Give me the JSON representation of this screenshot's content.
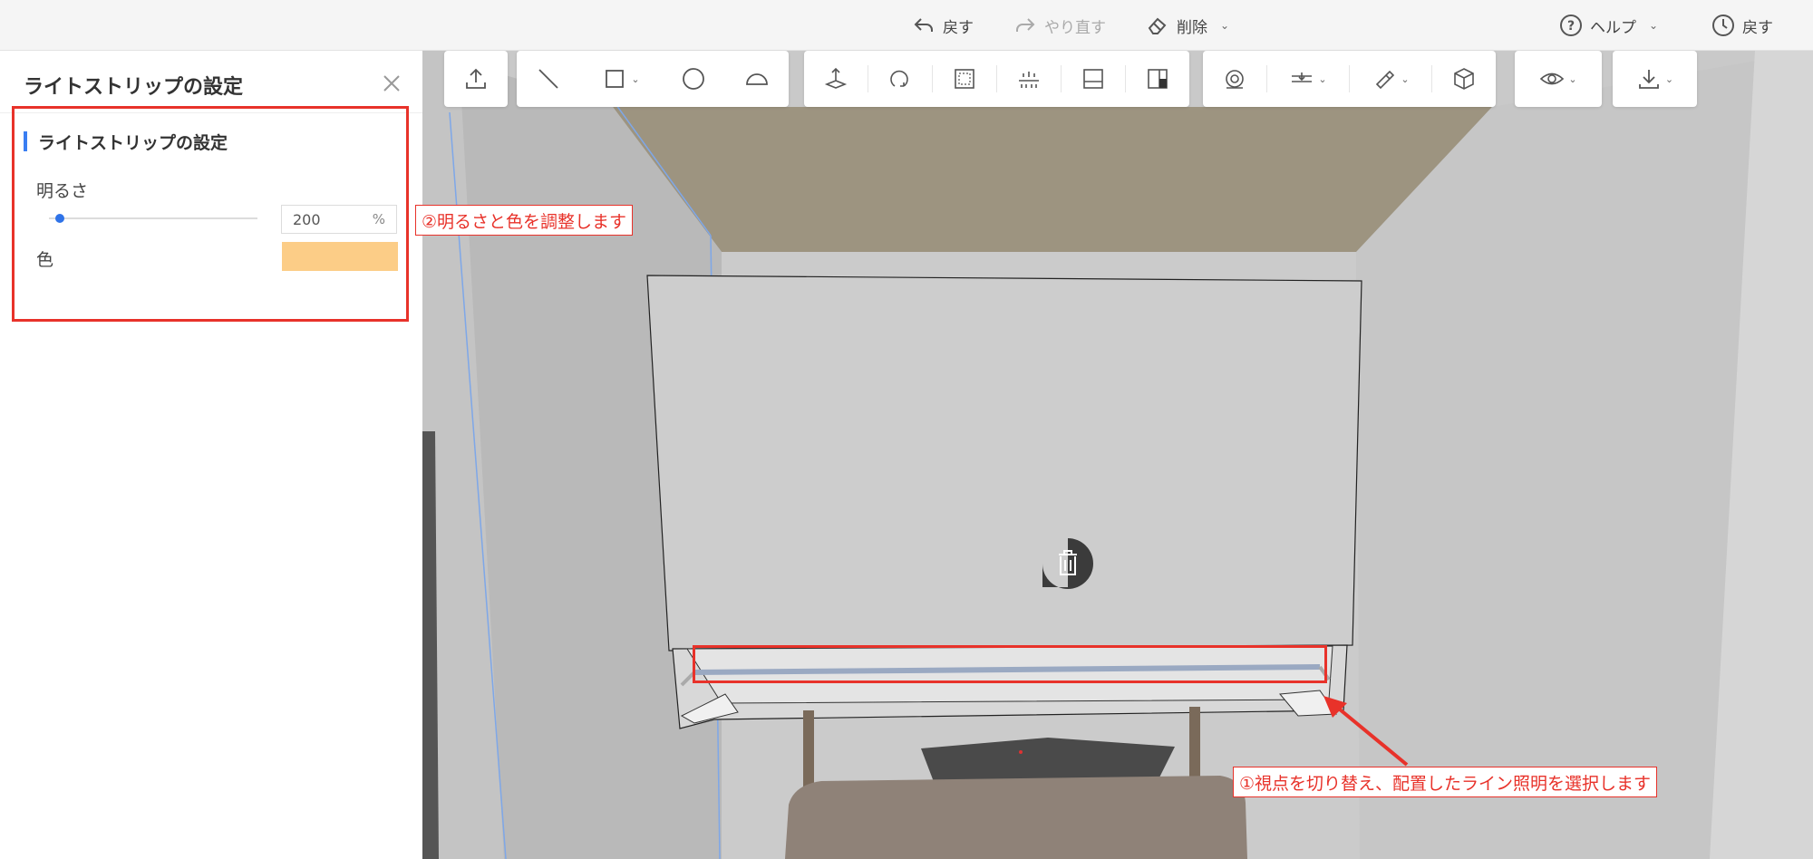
{
  "topbar": {
    "undo_label": "戻す",
    "redo_label": "やり直す",
    "delete_label": "削除",
    "help_label": "ヘルプ",
    "history_label": "戻す"
  },
  "panel": {
    "title": "ライトストリップの設定",
    "section_title": "ライトストリップの設定",
    "brightness_label": "明るさ",
    "brightness_value": "200",
    "brightness_unit": "%",
    "brightness_slider_level": 0.05,
    "color_label": "色",
    "color_value": "#fccd87"
  },
  "annotations": {
    "step2": "②明るさと色を調整します",
    "step1": "①視点を切り替え、配置したライン照明を選択します",
    "accent_color": "#e8322a"
  },
  "toolbar_icons": [
    "upload-icon",
    "line-icon",
    "rectangle-icon",
    "circle-icon",
    "arc-icon",
    "move-3d-icon",
    "rotate-icon",
    "frame-icon",
    "light-strip-icon",
    "cabinet-icon",
    "split-panel-icon",
    "tape-measure-icon",
    "level-icon",
    "paint-brush-icon",
    "cube-icon",
    "eye-icon",
    "download-icon"
  ]
}
